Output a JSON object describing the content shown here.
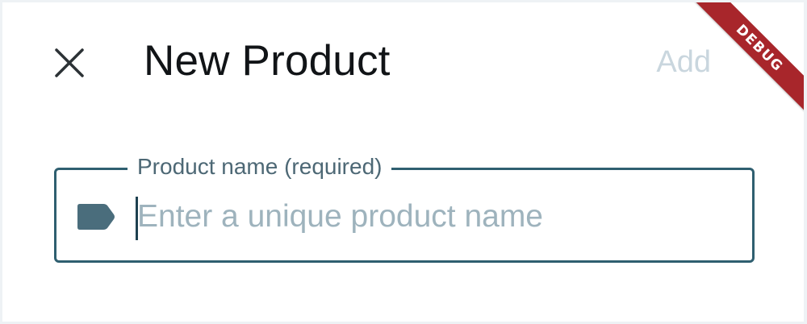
{
  "header": {
    "title": "New Product",
    "add_label": "Add",
    "close_icon": "close-icon"
  },
  "debug_banner": {
    "text": "DEBUG",
    "color": "#a8262b"
  },
  "form": {
    "product_name": {
      "label": "Product name (required)",
      "placeholder": "Enter a unique product name",
      "value": "",
      "icon": "label-tag-icon",
      "border_color": "#2f5f70"
    }
  },
  "colors": {
    "title": "#111417",
    "add_disabled": "#c9d6de",
    "icon": "#4a6d7c",
    "placeholder": "#9eb3bd"
  }
}
